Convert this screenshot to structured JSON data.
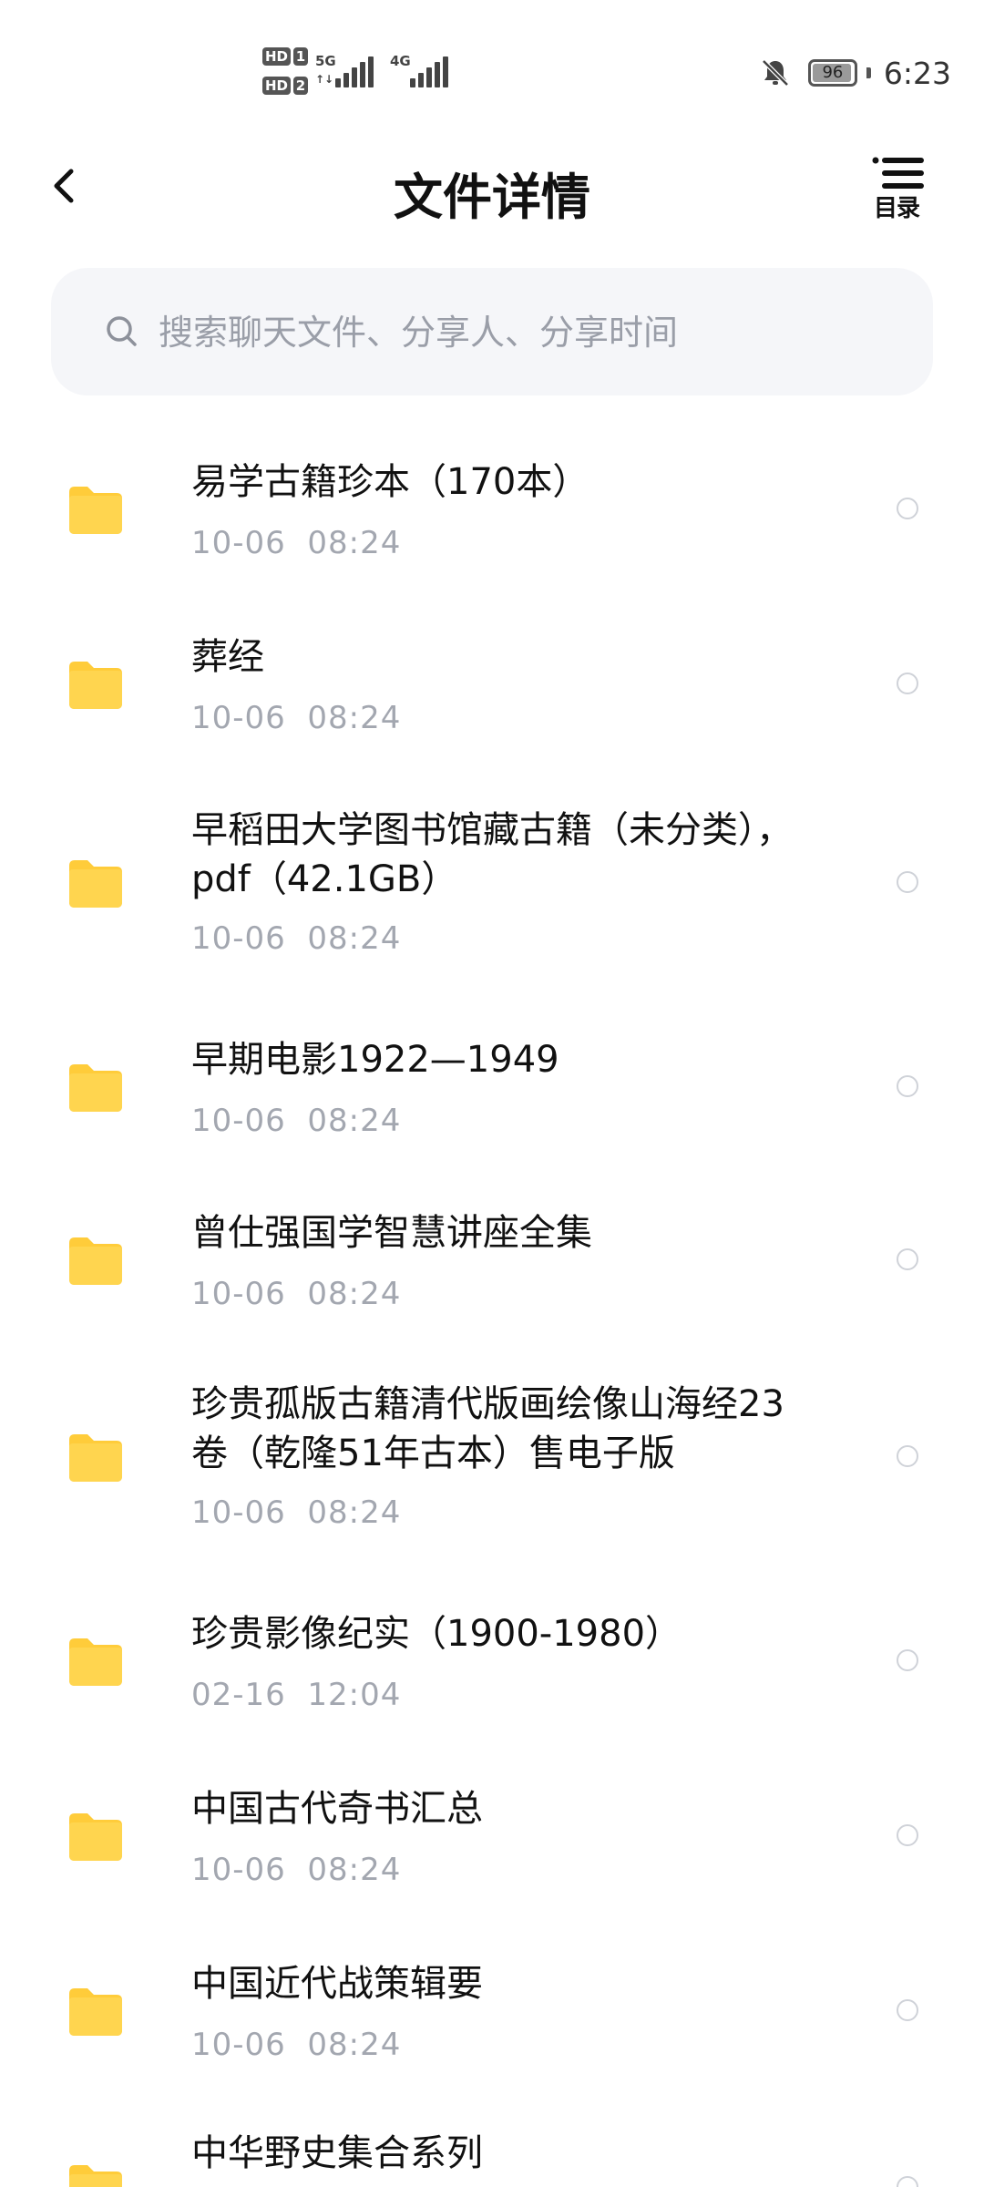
{
  "status_bar": {
    "hd1": "HD",
    "hd1_num": "1",
    "hd2": "HD",
    "hd2_num": "2",
    "sim1_network": "5G",
    "sim1_sub": "↑↓",
    "sim2_network": "4G",
    "battery_level": "96",
    "time": "6:23",
    "icons": [
      "signal-icon",
      "bell-muted-icon",
      "battery-icon"
    ]
  },
  "header": {
    "title": "文件详情",
    "toc_label": "目录",
    "icons": [
      "back-icon",
      "toc-icon"
    ]
  },
  "search": {
    "placeholder": "搜索聊天文件、分享人、分享时间",
    "icon": "search-icon"
  },
  "files": [
    {
      "name": "易学古籍珍本（170本）",
      "time": "10-06  08:24"
    },
    {
      "name": "葬经",
      "time": "10-06  08:24"
    },
    {
      "name": "早稻田大学图书馆藏古籍（未分类），pdf（42.1GB）",
      "time": "10-06  08:24"
    },
    {
      "name": "早期电影1922—1949",
      "time": "10-06  08:24"
    },
    {
      "name": "曾仕强国学智慧讲座全集",
      "time": "10-06  08:24"
    },
    {
      "name": "珍贵孤版古籍清代版画绘像山海经23卷（乾隆51年古本）售电子版",
      "time": "10-06  08:24"
    },
    {
      "name": "珍贵影像纪实（1900-1980）",
      "time": "02-16  12:04"
    },
    {
      "name": "中国古代奇书汇总",
      "time": "10-06  08:24"
    },
    {
      "name": "中国近代战策辑要",
      "time": "10-06  08:24"
    },
    {
      "name": "中华野史集合系列",
      "time": ""
    }
  ],
  "colors": {
    "folder": "#ffd54f",
    "folder_tab": "#ffcc3a",
    "time_text": "#a3a7b0",
    "search_bg": "#f5f6f9"
  }
}
